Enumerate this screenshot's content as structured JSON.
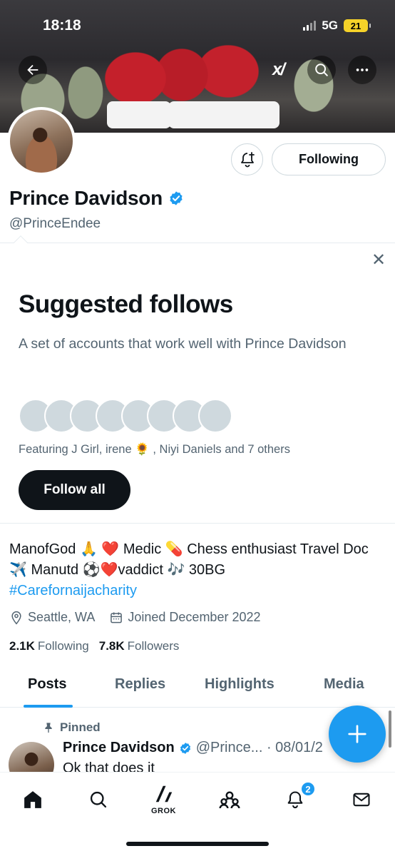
{
  "status_bar": {
    "time": "18:18",
    "network": "5G",
    "battery": "21"
  },
  "profile": {
    "name": "Prince Davidson",
    "handle": "@PrinceEndee",
    "following_button": "Following"
  },
  "suggested": {
    "title": "Suggested follows",
    "description": "A set of accounts that work well with Prince Davidson",
    "featuring": "Featuring J Girl, irene 🌻 , Niyi Daniels and 7 others",
    "follow_all": "Follow all",
    "close": "✕"
  },
  "bio": {
    "text": "ManofGod 🙏 ❤️ Medic 💊 Chess enthusiast Travel Doc ✈️ Manutd ⚽️❤️vaddict 🎶 30BG",
    "hashtag": "#Carefornaijacharity",
    "location": "Seattle, WA",
    "joined": "Joined December 2022"
  },
  "counts": {
    "following_value": "2.1K",
    "following_label": "Following",
    "followers_value": "7.8K",
    "followers_label": "Followers"
  },
  "tabs": [
    "Posts",
    "Replies",
    "Highlights",
    "Media"
  ],
  "post": {
    "pinned_label": "Pinned",
    "author": "Prince Davidson",
    "handle_date": "@Prince... · 08/01/2",
    "text": "Ok that does it"
  },
  "bottom_nav": {
    "grok_label": "GROK",
    "notifications_count": "2"
  },
  "colors": {
    "accent": "#1d9bf0",
    "text": "#0f1419",
    "muted": "#536471"
  }
}
